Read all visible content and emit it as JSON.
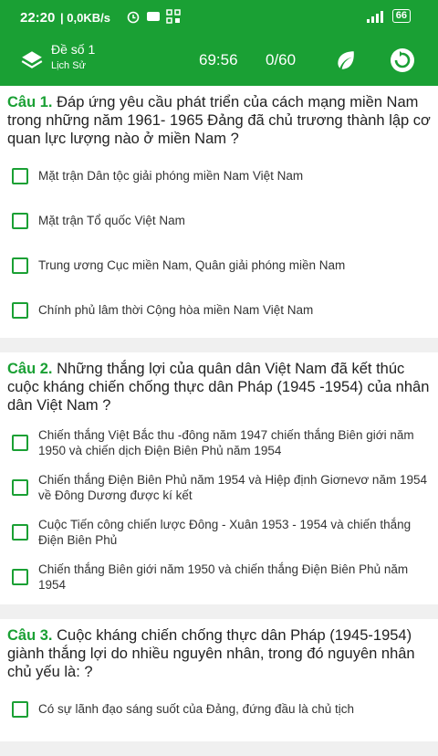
{
  "status_bar": {
    "time": "22:20",
    "network_speed": "| 0,0KB/s",
    "battery": "66"
  },
  "app_bar": {
    "title": "Đề số 1",
    "subtitle": "Lịch Sử",
    "timer": "69:56",
    "progress": "0/60"
  },
  "questions": [
    {
      "number": "Câu 1.",
      "text": "Đáp ứng yêu cầu phát triển của cách mạng miền Nam trong những năm 1961- 1965 Đảng đã chủ trương thành lập cơ quan lực lượng nào ở miền Nam ?",
      "options": [
        "Mặt trận Dân tộc giải phóng miền Nam Việt Nam",
        "Mặt trận Tổ quốc Việt Nam",
        "Trung ương Cục miền Nam, Quân giải phóng miền Nam",
        "Chính phủ lâm thời Cộng hòa miền Nam Việt Nam"
      ]
    },
    {
      "number": "Câu 2.",
      "text": "Những thắng lợi của quân dân Việt Nam đã kết thúc cuộc kháng chiến chống thực dân Pháp (1945 -1954) của nhân dân Việt Nam ?",
      "options": [
        "Chiến thắng Việt Bắc thu -đông năm 1947 chiến thắng Biên giới năm 1950 và chiến dịch Điện Biên Phủ năm 1954",
        "Chiến thắng Điện Biên Phủ năm 1954 và Hiệp định Giơnevơ năm 1954 về Đông Dương được kí kết",
        "Cuộc Tiến công chiến lược Đông - Xuân 1953 - 1954 và chiến thắng Điện Biên Phủ",
        "Chiến thắng Biên giới năm 1950 và chiến thắng Điện Biên Phủ năm 1954"
      ]
    },
    {
      "number": "Câu 3.",
      "text": "Cuộc kháng chiến chống thực dân Pháp (1945-1954) giành thắng lợi do nhiều nguyên nhân, trong đó nguyên nhân chủ yếu là: ?",
      "options": [
        "Có sự lãnh đạo sáng suốt của Đảng, đứng đầu là chủ tịch"
      ]
    }
  ]
}
